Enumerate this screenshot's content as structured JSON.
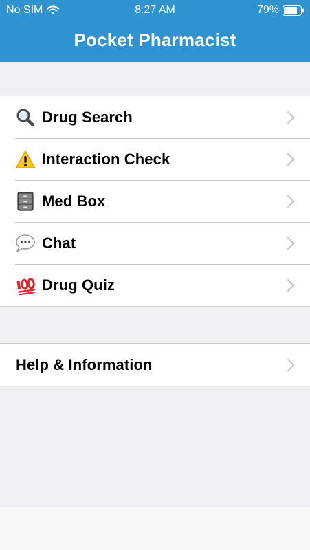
{
  "status_bar": {
    "carrier": "No SIM",
    "time": "8:27 AM",
    "battery_percent": "79%",
    "battery_level": 0.79
  },
  "nav": {
    "title": "Pocket Pharmacist"
  },
  "menu": {
    "items": [
      {
        "label": "Drug Search",
        "icon": "magnifying-glass-icon"
      },
      {
        "label": "Interaction Check",
        "icon": "warning-icon"
      },
      {
        "label": "Med Box",
        "icon": "file-cabinet-icon"
      },
      {
        "label": "Chat",
        "icon": "speech-bubble-icon"
      },
      {
        "label": "Drug Quiz",
        "icon": "hundred-points-icon"
      }
    ]
  },
  "secondary": {
    "items": [
      {
        "label": "Help & Information"
      }
    ]
  },
  "colors": {
    "header": "#2f93d1",
    "background": "#efeff4",
    "separator": "#c8c7cc",
    "chevron": "#c7c7cc"
  }
}
